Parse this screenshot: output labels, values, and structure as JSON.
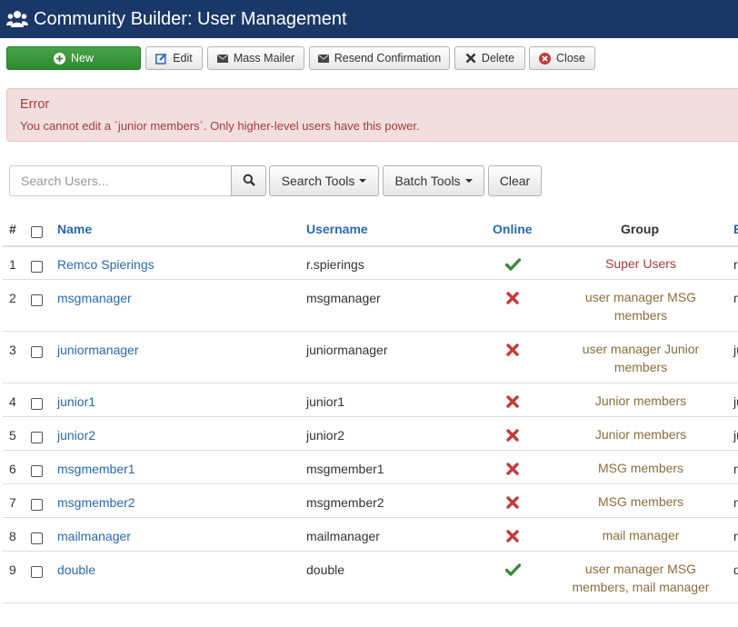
{
  "app": {
    "title": "Community Builder: User Management",
    "header_icon": "users-icon",
    "header_bg": "#1a3867"
  },
  "toolbar": {
    "new": "New",
    "edit": "Edit",
    "mass_mailer": "Mass Mailer",
    "resend_confirmation": "Resend Confirmation",
    "delete": "Delete",
    "close": "Close"
  },
  "alert": {
    "heading": "Error",
    "message": "You cannot edit a `junior members`. Only higher-level users have this power.",
    "color": "#a53d3b"
  },
  "search": {
    "placeholder": "Search Users...",
    "value": "",
    "search_tools": "Search Tools",
    "batch_tools": "Batch Tools",
    "clear": "Clear"
  },
  "table": {
    "headers": {
      "num": "#",
      "name": "Name",
      "username": "Username",
      "online": "Online",
      "group": "Group",
      "edge": "E"
    },
    "rows": [
      {
        "num": "1",
        "name": "Remco Spierings",
        "username": "r.spierings",
        "online": true,
        "group_line1": "Super Users",
        "group_line2": "",
        "group_link": "",
        "edge": "r"
      },
      {
        "num": "2",
        "name": "msgmanager",
        "username": "msgmanager",
        "online": false,
        "group_line1": "user manager MSG",
        "group_line2": "members",
        "group_link": "",
        "edge": "n"
      },
      {
        "num": "3",
        "name": "juniormanager",
        "username": "juniormanager",
        "online": false,
        "group_line1": "user manager Junior",
        "group_line2": "members",
        "group_link": "",
        "edge": "ju"
      },
      {
        "num": "4",
        "name": "junior1",
        "username": "junior1",
        "online": false,
        "group_line1": "Junior members",
        "group_line2": "",
        "group_link": "",
        "edge": "ju"
      },
      {
        "num": "5",
        "name": "junior2",
        "username": "junior2",
        "online": false,
        "group_line1": "Junior members",
        "group_line2": "",
        "group_link": "",
        "edge": "ju"
      },
      {
        "num": "6",
        "name": "msgmember1",
        "username": "msgmember1",
        "online": false,
        "group_line1": "MSG members",
        "group_line2": "",
        "group_link": "",
        "edge": "n"
      },
      {
        "num": "7",
        "name": "msgmember2",
        "username": "msgmember2",
        "online": false,
        "group_line1": "MSG members",
        "group_line2": "",
        "group_link": "",
        "edge": "n"
      },
      {
        "num": "8",
        "name": "mailmanager",
        "username": "mailmanager",
        "online": false,
        "group_line1": "mail manager",
        "group_line2": "",
        "group_link": "",
        "edge": "n"
      },
      {
        "num": "9",
        "name": "double",
        "username": "double",
        "online": true,
        "group_line1": "user manager MSG",
        "group_line2": "members",
        "group_link": "mail manager",
        "edge": "d"
      }
    ]
  },
  "colors": {
    "link": "#2a69b3",
    "online": "#3c8a3c",
    "offline": "#c43b3b",
    "super_group": "#a53d3b",
    "group": "#8a6d3b"
  }
}
